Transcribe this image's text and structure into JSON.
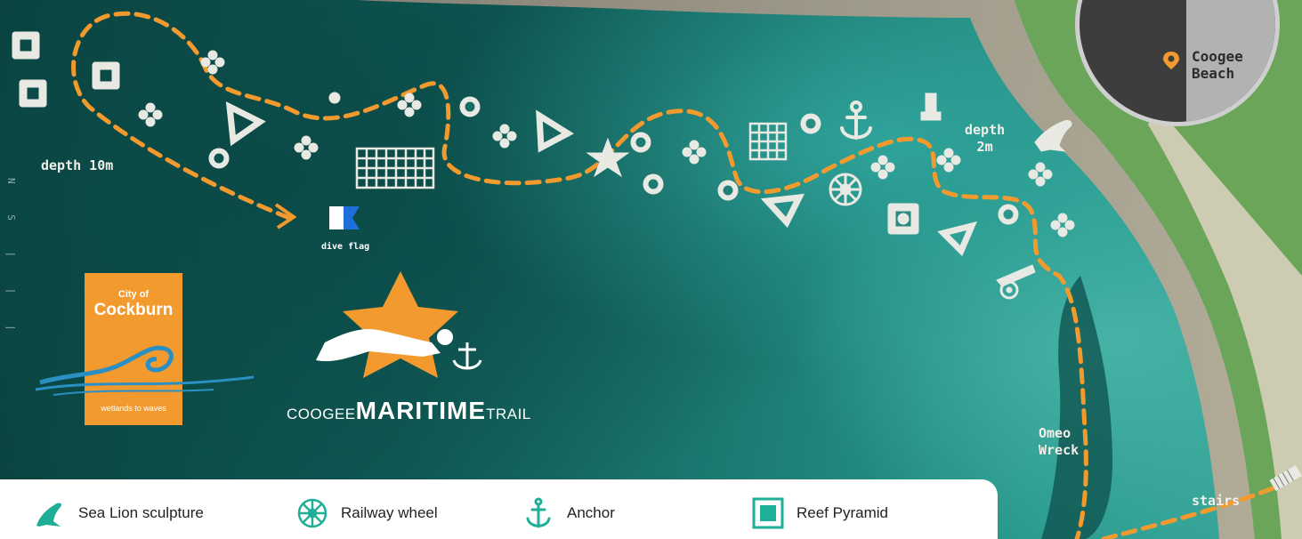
{
  "labels": {
    "depth_10m": "depth 10m",
    "depth_2m": "depth\n2m",
    "dive_flag": "dive flag",
    "omeo_wreck": "Omeo\nWreck",
    "stairs": "stairs"
  },
  "locator": {
    "place": "Coogee\nBeach"
  },
  "cockburn": {
    "line1": "City of",
    "line2": "Cockburn",
    "tagline": "wetlands to waves"
  },
  "trail_title": {
    "part1": "COOGEE",
    "part2": "MARITIME",
    "part3": "TRAIL"
  },
  "legend": [
    {
      "icon": "sea-lion-icon",
      "label": "Sea Lion sculpture"
    },
    {
      "icon": "railway-wheel-icon",
      "label": "Railway wheel"
    },
    {
      "icon": "anchor-icon",
      "label": "Anchor"
    },
    {
      "icon": "reef-pyramid-icon",
      "label": "Reef Pyramid"
    }
  ],
  "colors": {
    "route": "#f39a2e",
    "legend_icon": "#1fae96",
    "marker": "#e9e9e4",
    "brand_orange": "#f39a2e",
    "wave_blue": "#2a8fc3"
  }
}
